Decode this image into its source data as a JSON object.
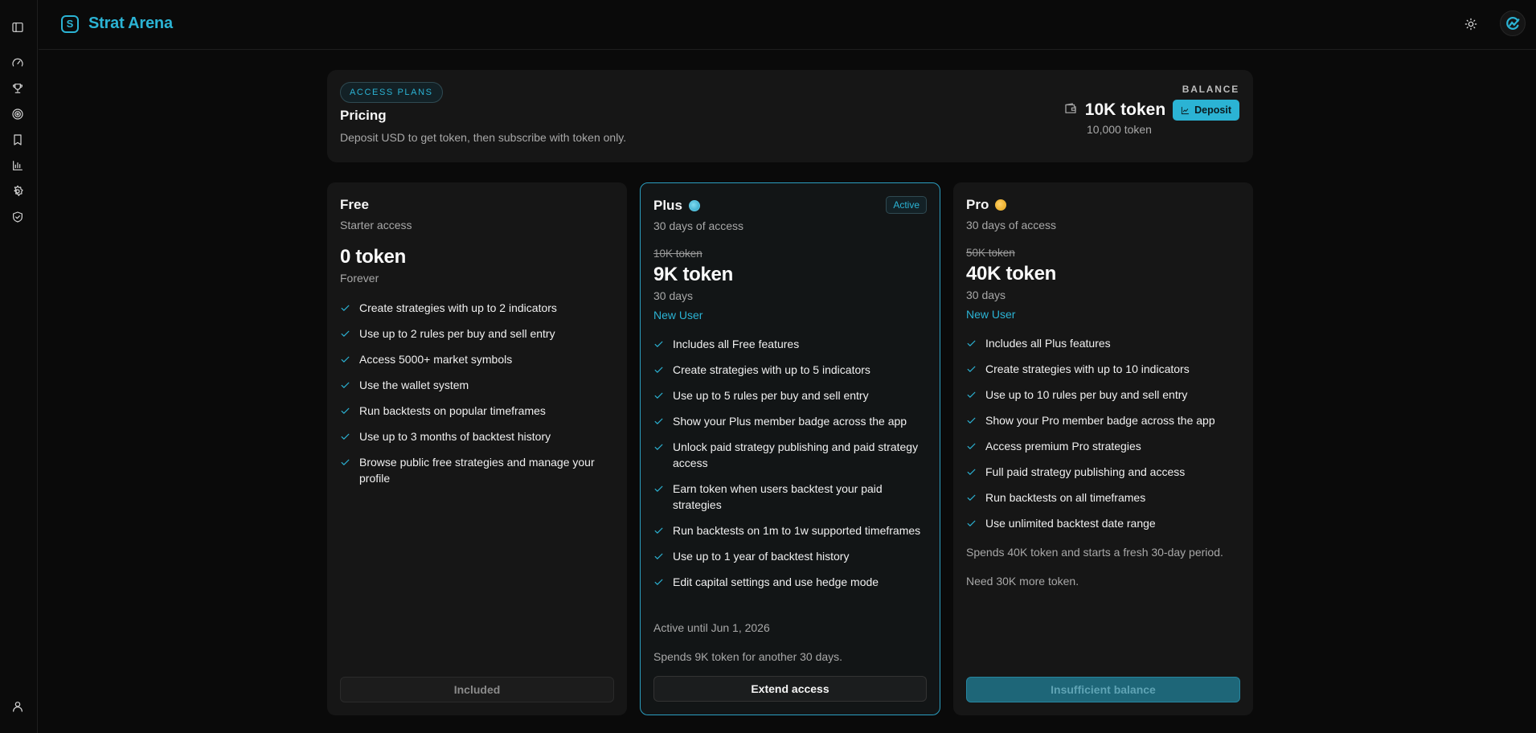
{
  "brand": {
    "logo_letter": "S",
    "name": "Strat Arena"
  },
  "sidebar": {
    "icons": [
      "panel-toggle-icon",
      "gauge-icon",
      "trophy-icon",
      "target-icon",
      "bookmark-icon",
      "chart-icon",
      "gear-icon",
      "shield-check-icon",
      "user-icon"
    ]
  },
  "header": {
    "theme_icon": "sun-icon",
    "avatar_icon": "app-logo-icon"
  },
  "pricing": {
    "pill": "ACCESS PLANS",
    "title": "Pricing",
    "description": "Deposit USD to get token, then subscribe with token only."
  },
  "balance": {
    "label": "BALANCE",
    "amount": "10K token",
    "exact": "10,000 token",
    "deposit_label": "Deposit"
  },
  "plans": [
    {
      "name": "Free",
      "subtitle": "Starter access",
      "price": "0 token",
      "period": "Forever",
      "features": [
        "Create strategies with up to 2 indicators",
        "Use up to 2 rules per buy and sell entry",
        "Access 5000+ market symbols",
        "Use the wallet system",
        "Run backtests on popular timeframes",
        "Use up to 3 months of backtest history",
        "Browse public free strategies and manage your profile"
      ],
      "button": "Included"
    },
    {
      "name": "Plus",
      "badge": "Active",
      "subtitle": "30 days of access",
      "original_price": "10K token",
      "price": "9K token",
      "period": "30 days",
      "tag": "New User",
      "features": [
        "Includes all Free features",
        "Create strategies with up to 5 indicators",
        "Use up to 5 rules per buy and sell entry",
        "Show your Plus member badge across the app",
        "Unlock paid strategy publishing and paid strategy access",
        "Earn token when users backtest your paid strategies",
        "Run backtests on 1m to 1w supported timeframes",
        "Use up to 1 year of backtest history",
        "Edit capital settings and use hedge mode"
      ],
      "note1": "Active until Jun 1, 2026",
      "note2": "Spends 9K token for another 30 days.",
      "button": "Extend access"
    },
    {
      "name": "Pro",
      "subtitle": "30 days of access",
      "original_price": "50K token",
      "price": "40K token",
      "period": "30 days",
      "tag": "New User",
      "features": [
        "Includes all Plus features",
        "Create strategies with up to 10 indicators",
        "Use up to 10 rules per buy and sell entry",
        "Show your Pro member badge across the app",
        "Access premium Pro strategies",
        "Full paid strategy publishing and access",
        "Run backtests on all timeframes",
        "Use unlimited backtest date range"
      ],
      "note1": "Spends 40K token and starts a fresh 30-day period.",
      "note2": "Need 30K more token.",
      "button": "Insufficient balance"
    }
  ],
  "colors": {
    "accent": "#2bb3d4",
    "background": "#0a0a0a",
    "card": "#161616",
    "pro_badge": "#e6a317"
  }
}
